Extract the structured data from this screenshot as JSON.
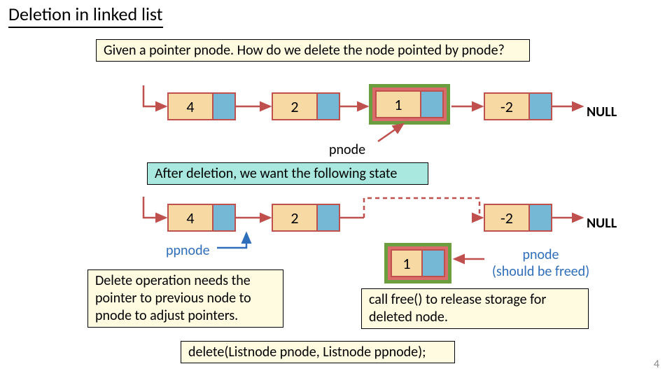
{
  "title": "Deletion in linked list",
  "question": "Given a pointer pnode. How do we delete the node pointed by pnode?",
  "nodes": {
    "v4": "4",
    "v2": "2",
    "v1": "1",
    "vm2": "-2"
  },
  "null_label": "NULL",
  "pnode_label": "pnode",
  "after_label": "After deletion, we want the following state",
  "ppnode_label": "ppnode",
  "pnode_freed_l1": "pnode",
  "pnode_freed_l2": "(should be freed)",
  "delete_note_l1": "Delete operation needs the",
  "delete_note_l2": "pointer to previous node to",
  "delete_note_l3": "pnode to adjust pointers.",
  "free_note_l1": "call free() to release storage for",
  "free_note_l2": "deleted node.",
  "signature": "delete(Listnode pnode, Listnode ppnode);",
  "pagenum": "4"
}
